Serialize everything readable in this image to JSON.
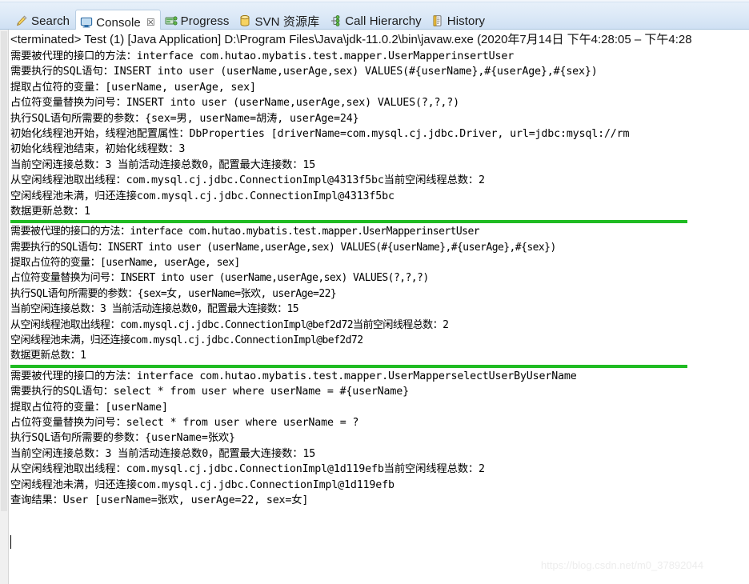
{
  "tabbar": {
    "tabs": [
      {
        "label": "Search",
        "icon": "search-pencil-icon",
        "active": false,
        "closable": false
      },
      {
        "label": "Console",
        "icon": "console-monitor-icon",
        "active": true,
        "closable": true,
        "close_glyph": "☒"
      },
      {
        "label": "Progress",
        "icon": "progress-icon",
        "active": false,
        "closable": false
      },
      {
        "label": "SVN 资源库",
        "icon": "svn-repository-icon",
        "active": false,
        "closable": false
      },
      {
        "label": "Call Hierarchy",
        "icon": "call-hierarchy-icon",
        "active": false,
        "closable": false
      },
      {
        "label": "History",
        "icon": "history-icon",
        "active": false,
        "closable": false
      }
    ]
  },
  "console": {
    "terminated_line": "<terminated> Test (1) [Java Application] D:\\Program Files\\Java\\jdk-11.0.2\\bin\\javaw.exe  (2020年7月14日 下午4:28:05 – 下午4:28",
    "watermark": "https://blog.csdn.net/m0_37892044",
    "green_separator_color": "#1fbb22",
    "lines": [
      {
        "type": "text",
        "text": "需要被代理的接口的方法：interface com.hutao.mybatis.test.mapper.UserMapperinsertUser",
        "style": "normal"
      },
      {
        "type": "text",
        "text": "需要执行的SQL语句：INSERT into user (userName,userAge,sex) VALUES(#{userName},#{userAge},#{sex})",
        "style": "normal"
      },
      {
        "type": "text",
        "text": "提取占位符的变量：[userName, userAge, sex]",
        "style": "normal"
      },
      {
        "type": "text",
        "text": "占位符变量替换为问号：INSERT into user (userName,userAge,sex) VALUES(?,?,?)",
        "style": "normal"
      },
      {
        "type": "text",
        "text": "执行SQL语句所需要的参数：{sex=男, userName=胡涛, userAge=24}",
        "style": "normal"
      },
      {
        "type": "text",
        "text": "初始化线程池开始，线程池配置属性：DbProperties [driverName=com.mysql.cj.jdbc.Driver, url=jdbc:mysql://rm",
        "style": "normal"
      },
      {
        "type": "text",
        "text": "初始化线程池结束，初始化线程数：3",
        "style": "normal"
      },
      {
        "type": "text",
        "text": "当前空闲连接总数：3 当前活动连接总数0，配置最大连接数：15",
        "style": "normal"
      },
      {
        "type": "text",
        "text": "从空闲线程池取出线程：com.mysql.cj.jdbc.ConnectionImpl@4313f5bc当前空闲线程总数：2",
        "style": "normal"
      },
      {
        "type": "text",
        "text": "空闲线程池未满，归还连接com.mysql.cj.jdbc.ConnectionImpl@4313f5bc",
        "style": "normal"
      },
      {
        "type": "text",
        "text": "数据更新总数：1",
        "style": "normal"
      },
      {
        "type": "separator"
      },
      {
        "type": "text",
        "text": "需要被代理的接口的方法：interface com.hutao.mybatis.test.mapper.UserMapperinsertUser",
        "style": "tight"
      },
      {
        "type": "text",
        "text": "需要执行的SQL语句：INSERT into user (userName,userAge,sex) VALUES(#{userName},#{userAge},#{sex})",
        "style": "tight"
      },
      {
        "type": "text",
        "text": "提取占位符的变量：[userName, userAge, sex]",
        "style": "tight"
      },
      {
        "type": "text",
        "text": "占位符变量替换为问号：INSERT into user (userName,userAge,sex) VALUES(?,?,?)",
        "style": "tight"
      },
      {
        "type": "text",
        "text": "执行SQL语句所需要的参数：{sex=女, userName=张欢, userAge=22}",
        "style": "tight"
      },
      {
        "type": "text",
        "text": "当前空闲连接总数：3 当前活动连接总数0，配置最大连接数：15",
        "style": "tight"
      },
      {
        "type": "text",
        "text": "从空闲线程池取出线程：com.mysql.cj.jdbc.ConnectionImpl@bef2d72当前空闲线程总数：2",
        "style": "tight"
      },
      {
        "type": "text",
        "text": "空闲线程池未满，归还连接com.mysql.cj.jdbc.ConnectionImpl@bef2d72",
        "style": "tight"
      },
      {
        "type": "text",
        "text": "数据更新总数：1",
        "style": "tight"
      },
      {
        "type": "separator"
      },
      {
        "type": "text",
        "text": "需要被代理的接口的方法：interface com.hutao.mybatis.test.mapper.UserMapperselectUserByUserName",
        "style": "normal"
      },
      {
        "type": "text",
        "text": "需要执行的SQL语句：select * from user where userName = #{userName}",
        "style": "normal"
      },
      {
        "type": "text",
        "text": "提取占位符的变量：[userName]",
        "style": "normal"
      },
      {
        "type": "text",
        "text": "占位符变量替换为问号：select * from user where userName = ?",
        "style": "normal"
      },
      {
        "type": "text",
        "text": "执行SQL语句所需要的参数：{userName=张欢}",
        "style": "normal"
      },
      {
        "type": "text",
        "text": "当前空闲连接总数：3 当前活动连接总数0，配置最大连接数：15",
        "style": "normal"
      },
      {
        "type": "text",
        "text": "从空闲线程池取出线程：com.mysql.cj.jdbc.ConnectionImpl@1d119efb当前空闲线程总数：2",
        "style": "normal"
      },
      {
        "type": "text",
        "text": "空闲线程池未满，归还连接com.mysql.cj.jdbc.ConnectionImpl@1d119efb",
        "style": "normal"
      },
      {
        "type": "text",
        "text": "查询结果：User [userName=张欢, userAge=22, sex=女]",
        "style": "normal"
      }
    ]
  }
}
